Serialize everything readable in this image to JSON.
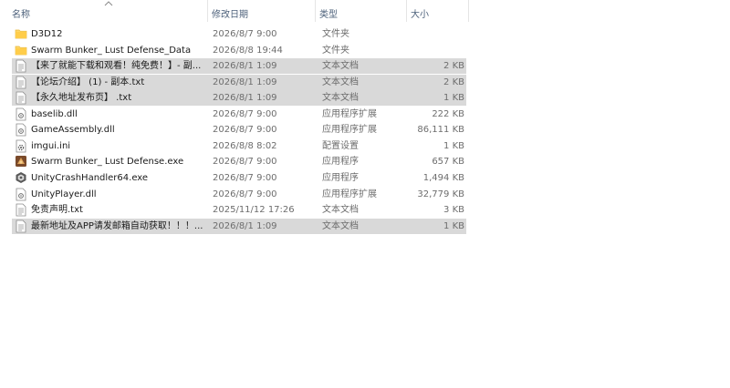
{
  "columns": {
    "name": "名称",
    "date": "修改日期",
    "type": "类型",
    "size": "大小"
  },
  "files": [
    {
      "name": "D3D12",
      "date": "2026/8/7 9:00",
      "type": "文件夹",
      "size": "",
      "icon": "folder-icon",
      "selected": false
    },
    {
      "name": "Swarm Bunker_ Lust Defense_Data",
      "date": "2026/8/8 19:44",
      "type": "文件夹",
      "size": "",
      "icon": "folder-icon",
      "selected": false
    },
    {
      "name": "【来了就能下载和观看！纯免费！】- 副...",
      "date": "2026/8/1 1:09",
      "type": "文本文档",
      "size": "2 KB",
      "icon": "text-file-icon",
      "selected": true
    },
    {
      "name": "【论坛介绍】 (1) - 副本.txt",
      "date": "2026/8/1 1:09",
      "type": "文本文档",
      "size": "2 KB",
      "icon": "text-file-icon",
      "selected": true
    },
    {
      "name": "【永久地址发布页】 .txt",
      "date": "2026/8/1 1:09",
      "type": "文本文档",
      "size": "1 KB",
      "icon": "text-file-icon",
      "selected": true
    },
    {
      "name": "baselib.dll",
      "date": "2026/8/7 9:00",
      "type": "应用程序扩展",
      "size": "222 KB",
      "icon": "dll-file-icon",
      "selected": false
    },
    {
      "name": "GameAssembly.dll",
      "date": "2026/8/7 9:00",
      "type": "应用程序扩展",
      "size": "86,111 KB",
      "icon": "dll-file-icon",
      "selected": false
    },
    {
      "name": "imgui.ini",
      "date": "2026/8/8 8:02",
      "type": "配置设置",
      "size": "1 KB",
      "icon": "ini-file-icon",
      "selected": false
    },
    {
      "name": "Swarm Bunker_ Lust Defense.exe",
      "date": "2026/8/7 9:00",
      "type": "应用程序",
      "size": "657 KB",
      "icon": "game-exe-icon",
      "selected": false
    },
    {
      "name": "UnityCrashHandler64.exe",
      "date": "2026/8/7 9:00",
      "type": "应用程序",
      "size": "1,494 KB",
      "icon": "unity-exe-icon",
      "selected": false
    },
    {
      "name": "UnityPlayer.dll",
      "date": "2026/8/7 9:00",
      "type": "应用程序扩展",
      "size": "32,779 KB",
      "icon": "dll-file-icon",
      "selected": false
    },
    {
      "name": "免责声明.txt",
      "date": "2025/11/12 17:26",
      "type": "文本文档",
      "size": "3 KB",
      "icon": "text-file-icon",
      "selected": false
    },
    {
      "name": "最新地址及APP请发邮箱自动获取！！！...",
      "date": "2026/8/1 1:09",
      "type": "文本文档",
      "size": "1 KB",
      "icon": "text-file-icon",
      "selected": true
    }
  ]
}
